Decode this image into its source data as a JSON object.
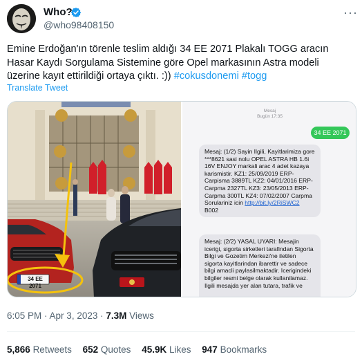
{
  "author": {
    "display_name": "Who?",
    "handle": "@who98408150"
  },
  "tweet": {
    "text_main": "Emine Erdoğan'ın törenle teslim aldığı 34 EE 2071 Plakalı TOGG aracın Hasar Kaydı Sorgulama Sistemine göre Opel markasının Astra modeli üzerine kayıt ettirildiği ortaya çıktı. :)) ",
    "hashtag_1": "#cokusdonemi",
    "hashtag_2": "#togg",
    "translate_label": "Translate Tweet"
  },
  "photo": {
    "plate_left": "34 EE 2071"
  },
  "sms": {
    "header_title": "Mesaj",
    "header_time": "Bugün 17:35",
    "sent_message": "34 EE 2071",
    "reply_1_text": "Mesaj: (1/2) Sayin Ilgili, Kayitlarimiza gore ***8621 sasi nolu OPEL ASTRA HB 1.6i 16V ENJOY markali arac 4 adet kazaya karismistir. KZ1: 25/09/2019 ERP-Carpisma 3889TL KZ2: 04/01/2016 ERP-Carpma 2327TL KZ3: 23/05/2013 ERP-Carpma 300TL KZ4: 07/02/2007 Carpma Sorulariniz icin ",
    "reply_1_link": "http://bit.ly/2RiSWC2",
    "reply_1_tail": " B002",
    "reply_2_text": "Mesaj: (2/2) YASAL UYARI: Mesajin icerigi, sigorta sirketleri tarafindan Sigorta Bilgi ve Gozetim Merkezi'ne iletilen sigorta kayitlarindan ibarettir ve sadece bilgi amacli paylasilmaktadir. Icerigindeki bilgiler resmi belge olarak kullanilamaz. Ilgili mesajda yer alan tutara, trafik ve"
  },
  "meta": {
    "time": "6:05 PM",
    "separator": " · ",
    "date": "Apr 3, 2023",
    "dot": " · ",
    "views_count": "7.3M",
    "views_label": " Views"
  },
  "stats": {
    "retweets_count": "5,866",
    "retweets_label": "Retweets",
    "quotes_count": "652",
    "quotes_label": "Quotes",
    "likes_count": "45.9K",
    "likes_label": "Likes",
    "bookmarks_count": "947",
    "bookmarks_label": "Bookmarks"
  },
  "colors": {
    "accent": "#1d9bf0",
    "sms_green": "#34c759",
    "sms_gray": "#e5e5ea"
  },
  "icons": [
    "avatar-mask",
    "verified-badge-icon",
    "more-options-icon",
    "annotation-arrow"
  ]
}
